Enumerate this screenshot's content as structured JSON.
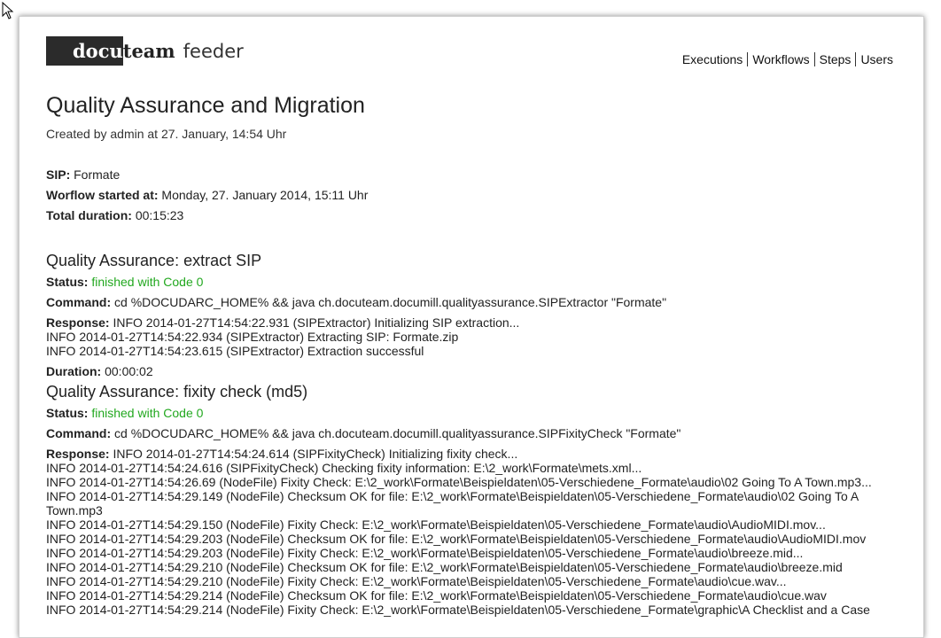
{
  "logo": {
    "part1": "docu",
    "part2": "team",
    "part3": "feeder"
  },
  "nav": [
    "Executions",
    "Workflows",
    "Steps",
    "Users"
  ],
  "page": {
    "title": "Quality Assurance and Migration",
    "created": "Created by admin at 27. January, 14:54 Uhr"
  },
  "meta": {
    "sip_label": "SIP:",
    "sip_value": " Formate",
    "started_label": "Worflow started at:",
    "started_value": " Monday, 27. January 2014, 15:11 Uhr",
    "duration_label": "Total duration:",
    "duration_value": " 00:15:23"
  },
  "steps": [
    {
      "title": "Quality Assurance: extract SIP",
      "status_label": "Status:",
      "status_value": " finished with Code 0",
      "command_label": "Command:",
      "command_value": " cd %DOCUDARC_HOME% && java ch.docuteam.documill.qualityassurance.SIPExtractor \"Formate\"",
      "response_label": "Response:",
      "response_lines": [
        " INFO 2014-01-27T14:54:22.931 (SIPExtractor) Initializing SIP extraction...",
        "INFO 2014-01-27T14:54:22.934 (SIPExtractor) Extracting SIP: Formate.zip",
        "INFO 2014-01-27T14:54:23.615 (SIPExtractor) Extraction successful"
      ],
      "duration_label": "Duration:",
      "duration_value": " 00:00:02"
    },
    {
      "title": "Quality Assurance: fixity check (md5)",
      "status_label": "Status:",
      "status_value": " finished with Code 0",
      "command_label": "Command:",
      "command_value": " cd %DOCUDARC_HOME% && java ch.docuteam.documill.qualityassurance.SIPFixityCheck \"Formate\"",
      "response_label": "Response:",
      "response_lines": [
        " INFO 2014-01-27T14:54:24.614 (SIPFixityCheck) Initializing fixity check...",
        "INFO 2014-01-27T14:54:24.616 (SIPFixityCheck) Checking fixity information: E:\\2_work\\Formate\\mets.xml...",
        "INFO 2014-01-27T14:54:26.69 (NodeFile) Fixity Check: E:\\2_work\\Formate\\Beispieldaten\\05-Verschiedene_Formate\\audio\\02 Going To A Town.mp3...",
        "INFO 2014-01-27T14:54:29.149 (NodeFile) Checksum OK for file: E:\\2_work\\Formate\\Beispieldaten\\05-Verschiedene_Formate\\audio\\02 Going To A",
        "Town.mp3",
        "INFO 2014-01-27T14:54:29.150 (NodeFile) Fixity Check: E:\\2_work\\Formate\\Beispieldaten\\05-Verschiedene_Formate\\audio\\AudioMIDI.mov...",
        "INFO 2014-01-27T14:54:29.203 (NodeFile) Checksum OK for file: E:\\2_work\\Formate\\Beispieldaten\\05-Verschiedene_Formate\\audio\\AudioMIDI.mov",
        "INFO 2014-01-27T14:54:29.203 (NodeFile) Fixity Check: E:\\2_work\\Formate\\Beispieldaten\\05-Verschiedene_Formate\\audio\\breeze.mid...",
        "INFO 2014-01-27T14:54:29.210 (NodeFile) Checksum OK for file: E:\\2_work\\Formate\\Beispieldaten\\05-Verschiedene_Formate\\audio\\breeze.mid",
        "INFO 2014-01-27T14:54:29.210 (NodeFile) Fixity Check: E:\\2_work\\Formate\\Beispieldaten\\05-Verschiedene_Formate\\audio\\cue.wav...",
        "INFO 2014-01-27T14:54:29.214 (NodeFile) Checksum OK for file: E:\\2_work\\Formate\\Beispieldaten\\05-Verschiedene_Formate\\audio\\cue.wav",
        "INFO 2014-01-27T14:54:29.214 (NodeFile) Fixity Check: E:\\2_work\\Formate\\Beispieldaten\\05-Verschiedene_Formate\\graphic\\A Checklist and a Case"
      ]
    }
  ]
}
